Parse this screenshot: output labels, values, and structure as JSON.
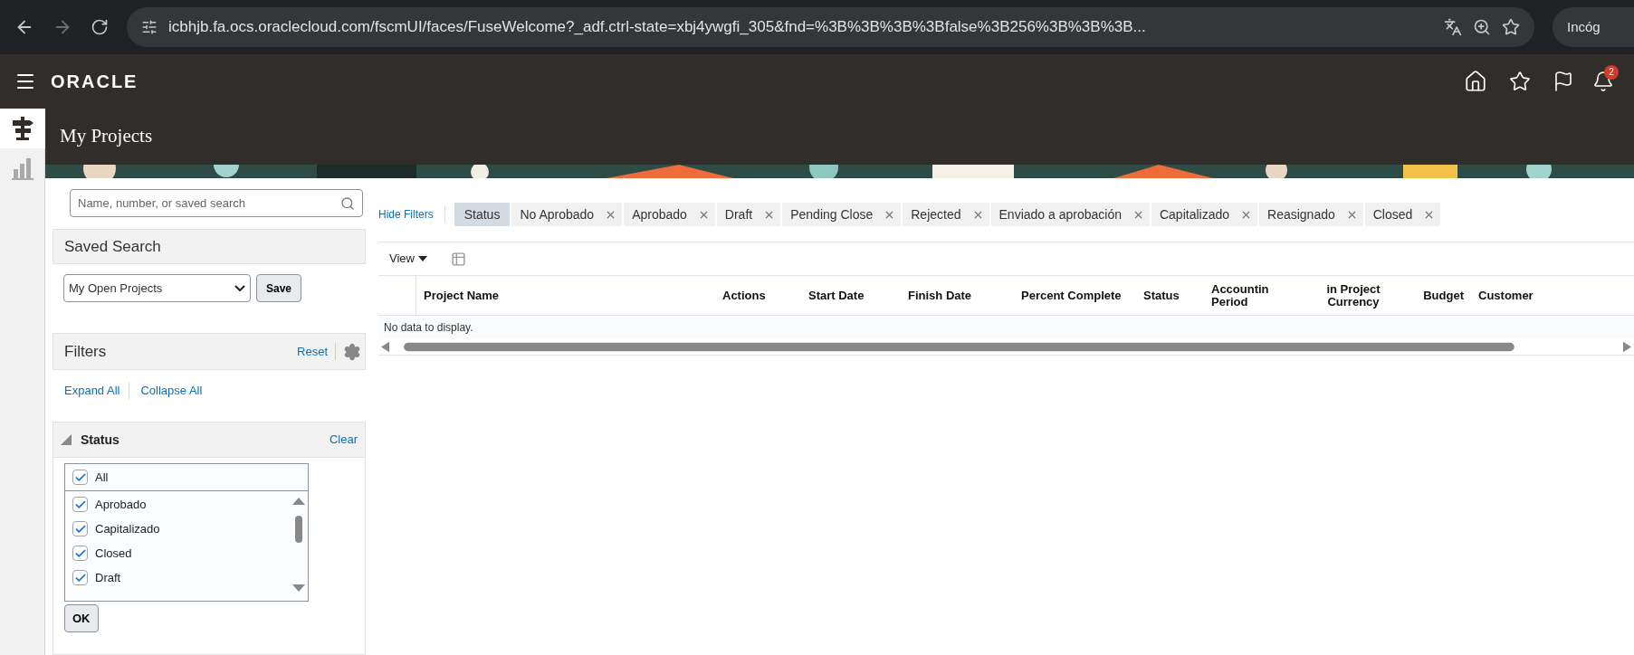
{
  "browser": {
    "url": "icbhjb.fa.ocs.oraclecloud.com/fscmUI/faces/FuseWelcome?_adf.ctrl-state=xbj4ywgfi_305&fnd=%3B%3B%3B%3Bfalse%3B256%3B%3B%3B...",
    "profile": "Incóg"
  },
  "app": {
    "brand": "ORACLE",
    "notification_count": "2"
  },
  "rail": [
    {
      "kind": "signpost",
      "selected": true
    },
    {
      "kind": "chart",
      "selected": false
    }
  ],
  "page_title": "My Projects",
  "search": {
    "placeholder": "Name, number, or saved search"
  },
  "saved_search": {
    "title": "Saved Search",
    "value": "My Open Projects",
    "save": "Save"
  },
  "filters": {
    "title": "Filters",
    "reset": "Reset",
    "expand_all": "Expand All",
    "collapse_all": "Collapse All"
  },
  "status_filter": {
    "title": "Status",
    "expanded": true,
    "clear": "Clear",
    "all": {
      "label": "All",
      "checked": true
    },
    "options": [
      {
        "label": "Aprobado",
        "checked": true
      },
      {
        "label": "Capitalizado",
        "checked": true
      },
      {
        "label": "Closed",
        "checked": true
      },
      {
        "label": "Draft",
        "checked": true
      }
    ],
    "ok": "OK"
  },
  "hide_filters": "Hide Filters",
  "chip_group": "Status",
  "chips": [
    "No Aprobado",
    "Aprobado",
    "Draft",
    "Pending Close",
    "Rejected",
    "Enviado a aprobación",
    "Capitalizado",
    "Reasignado",
    "Closed"
  ],
  "toolbar": {
    "view": "View"
  },
  "table": {
    "columns": [
      "Project Name",
      "Actions",
      "Start Date",
      "Finish Date",
      "Percent Complete",
      "Status",
      "Accountin\nPeriod",
      "in Project\nCurrency",
      "Budget",
      "Customer"
    ],
    "empty": "No data to display."
  }
}
